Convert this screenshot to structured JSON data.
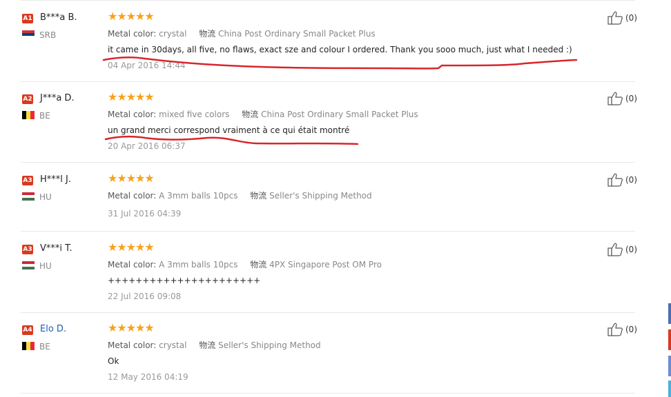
{
  "reviews": [
    {
      "badge": "A1",
      "name": "B***a B.",
      "country": "SRB",
      "flag": [
        "#c6363c",
        "#0c4076",
        "#ffffff"
      ],
      "flag_dir": "h",
      "stars": "★★★★★",
      "metal_label": "Metal color:",
      "metal_value": "crystal",
      "ship_label": "物流",
      "ship_value": "China Post Ordinary Small Packet Plus",
      "comment": "it came in 30days, all five, no flaws, exact sze and colour I ordered. Thank you sooo much, just what I needed :)",
      "date": "04 Apr 2016 14:44",
      "likes": "(0)",
      "name_link": false
    },
    {
      "badge": "A2",
      "name": "J***a D.",
      "country": "BE",
      "flag": [
        "#000000",
        "#fae042",
        "#ed2939"
      ],
      "flag_dir": "v",
      "stars": "★★★★★",
      "metal_label": "Metal color:",
      "metal_value": "mixed five colors",
      "ship_label": "物流",
      "ship_value": "China Post Ordinary Small Packet Plus",
      "comment": "un grand merci correspond vraiment à ce qui était montré",
      "date": "20 Apr 2016 06:37",
      "likes": "(0)",
      "name_link": false
    },
    {
      "badge": "A3",
      "name": "H***l J.",
      "country": "HU",
      "flag": [
        "#ce2939",
        "#ffffff",
        "#477050"
      ],
      "flag_dir": "h",
      "stars": "★★★★★",
      "metal_label": "Metal color:",
      "metal_value": "A 3mm balls 10pcs",
      "ship_label": "物流",
      "ship_value": "Seller's Shipping Method",
      "comment": "",
      "date": "31 Jul 2016 04:39",
      "likes": "(0)",
      "name_link": false
    },
    {
      "badge": "A3",
      "name": "V***i T.",
      "country": "HU",
      "flag": [
        "#ce2939",
        "#ffffff",
        "#477050"
      ],
      "flag_dir": "h",
      "stars": "★★★★★",
      "metal_label": "Metal color:",
      "metal_value": "A 3mm balls 10pcs",
      "ship_label": "物流",
      "ship_value": "4PX Singapore Post OM Pro",
      "comment": "++++++++++++++++++++++",
      "date": "22 Jul 2016 09:08",
      "likes": "(0)",
      "name_link": false
    },
    {
      "badge": "A4",
      "name": "Elo D.",
      "country": "BE",
      "flag": [
        "#000000",
        "#fae042",
        "#ed2939"
      ],
      "flag_dir": "v",
      "stars": "★★★★★",
      "metal_label": "Metal color:",
      "metal_value": "crystal",
      "ship_label": "物流",
      "ship_value": "Seller's Shipping Method",
      "comment": "Ok",
      "date": "12 May 2016 04:19",
      "likes": "(0)",
      "name_link": true
    }
  ],
  "colors": {
    "badge": "#d9391e",
    "stars": "#f7a21c",
    "annotation": "#d8252a",
    "link": "#1a5fb4"
  }
}
